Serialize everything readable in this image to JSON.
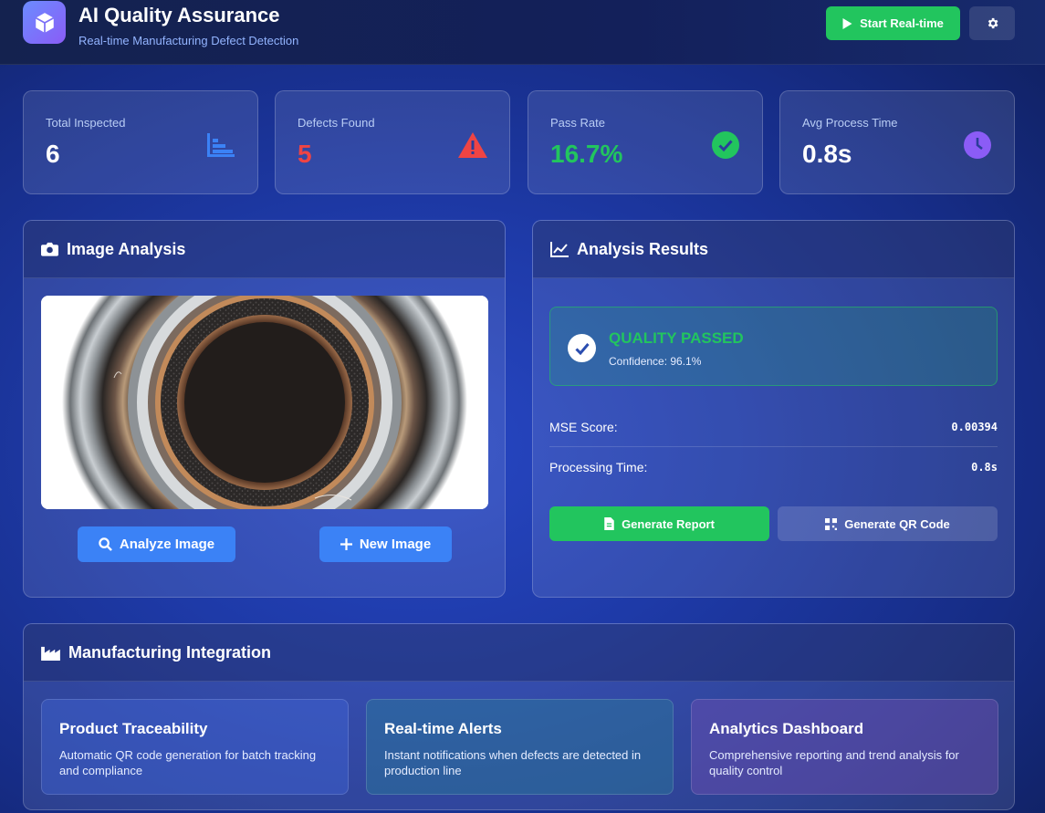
{
  "header": {
    "title": "AI Quality Assurance",
    "subtitle": "Real-time Manufacturing Defect Detection",
    "realtime_label": "Start Real-time"
  },
  "stats": [
    {
      "label": "Total Inspected",
      "value": "6",
      "color": "#ffffff",
      "icon": "bar-chart-icon",
      "icon_color": "#3b82f6"
    },
    {
      "label": "Defects Found",
      "value": "5",
      "color": "#ef4444",
      "icon": "warning-icon",
      "icon_color": "#ef4444"
    },
    {
      "label": "Pass Rate",
      "value": "16.7%",
      "color": "#22c55e",
      "icon": "check-circle-icon",
      "icon_color": "#22c55e"
    },
    {
      "label": "Avg Process Time",
      "value": "0.8s",
      "color": "#ffffff",
      "icon": "clock-icon",
      "icon_color": "#8b5cf6"
    }
  ],
  "image_panel": {
    "title": "Image Analysis",
    "analyze_label": "Analyze Image",
    "new_label": "New Image"
  },
  "results_panel": {
    "title": "Analysis Results",
    "status": "QUALITY PASSED",
    "confidence": "Confidence: 96.1%",
    "metrics": [
      {
        "label": "MSE Score:",
        "value": "0.00394"
      },
      {
        "label": "Processing Time:",
        "value": "0.8s"
      }
    ],
    "report_label": "Generate Report",
    "qr_label": "Generate QR Code"
  },
  "integration": {
    "title": "Manufacturing Integration",
    "features": [
      {
        "title": "Product Traceability",
        "desc": "Automatic QR code generation for batch tracking and compliance"
      },
      {
        "title": "Real-time Alerts",
        "desc": "Instant notifications when defects are detected in production line"
      },
      {
        "title": "Analytics Dashboard",
        "desc": "Comprehensive reporting and trend analysis for quality control"
      }
    ]
  },
  "colors": {
    "accent_green": "#22c55e",
    "accent_blue": "#3b82f6",
    "danger": "#ef4444",
    "purple": "#8b5cf6"
  }
}
